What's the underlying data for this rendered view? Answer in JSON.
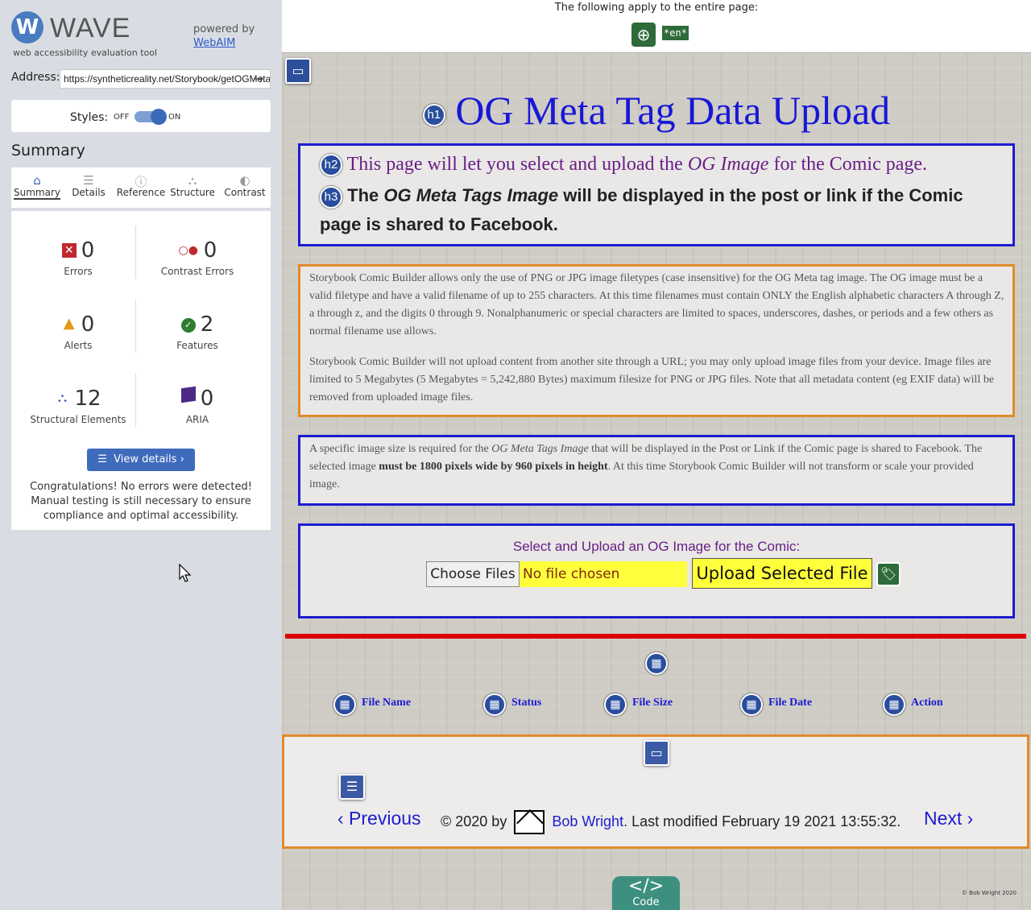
{
  "wave": {
    "logo_letter": "W",
    "logo_name": "WAVE",
    "tagline": "web accessibility evaluation tool",
    "powered_by": "powered by",
    "webaim_link": "WebAIM",
    "address_label": "Address:",
    "address_value": "https://syntheticreality.net/Storybook/getOGMetaImage.php",
    "styles_label": "Styles:",
    "styles_off": "OFF",
    "styles_on": "ON",
    "summary_heading": "Summary",
    "tabs": [
      {
        "label": "Summary",
        "icon": "home-icon"
      },
      {
        "label": "Details",
        "icon": "list-icon"
      },
      {
        "label": "Reference",
        "icon": "info-icon"
      },
      {
        "label": "Structure",
        "icon": "structure-icon"
      },
      {
        "label": "Contrast",
        "icon": "contrast-icon"
      }
    ],
    "stats": {
      "errors": {
        "count": "0",
        "label": "Errors"
      },
      "contrast": {
        "count": "0",
        "label": "Contrast Errors"
      },
      "alerts": {
        "count": "0",
        "label": "Alerts"
      },
      "features": {
        "count": "2",
        "label": "Features"
      },
      "structural": {
        "count": "12",
        "label": "Structural Elements"
      },
      "aria": {
        "count": "0",
        "label": "ARIA"
      }
    },
    "view_details": "View details ›",
    "congrats": "Congratulations! No errors were detected! Manual testing is still necessary to ensure compliance and optimal accessibility."
  },
  "page": {
    "notice": "The following apply to the entire page:",
    "lang_badge": "*en*",
    "h1_badge": "h1",
    "h1": "OG Meta Tag Data Upload",
    "h2_badge": "h2",
    "h2_pre": "This page will let you select and upload the ",
    "h2_em": "OG Image",
    "h2_post": " for the Comic page.",
    "h3_badge": "h3",
    "h3_pre": "The ",
    "h3_em": "OG Meta Tags Image",
    "h3_post": " will be displayed in the post or link if the Comic page is shared to Facebook.",
    "para1": "Storybook Comic Builder allows only the use of PNG or JPG image filetypes (case insensitive) for the OG Meta tag image. The OG image must be a valid filetype and have a valid filename of up to 255 characters. At this time filenames must contain ONLY the English alphabetic characters A through Z, a through z, and the digits 0 through 9. Nonalphanumeric or special characters are limited to spaces, underscores, dashes, or periods and a few others as normal filename use allows.",
    "para2": "Storybook Comic Builder will not upload content from another site through a URL; you may only upload image files from your device. Image files are limited to 5 Megabytes (5 Megabytes = 5,242,880 Bytes) maximum filesize for PNG or JPG files. Note that all metadata content (eg EXIF data) will be removed from uploaded image files.",
    "para3_pre": "A specific image size is required for the ",
    "para3_em": "OG Meta Tags Image",
    "para3_mid": " that will be displayed in the Post or Link if the Comic page is shared to Facebook. The selected image ",
    "para3_b": "must be 1800 pixels wide by 960 pixels in height",
    "para3_post": ". At this time Storybook Comic Builder will not transform or scale your provided image.",
    "upload_title": "Select and Upload an OG Image for the Comic:",
    "choose_files": "Choose Files",
    "no_file": "No file chosen",
    "upload_button": "Upload Selected File",
    "table_headers": [
      "File Name",
      "Status",
      "File Size",
      "File Date",
      "Action"
    ],
    "prev": "‹ Previous",
    "next": "Next ›",
    "copyright": "© 2020 by",
    "author": "Bob Wright",
    "modified": ". Last modified February 19 2021 13:55:32.",
    "code_label": "Code",
    "code_glyph": "</>",
    "tiny_credit": "© Bob Wright 2020"
  }
}
